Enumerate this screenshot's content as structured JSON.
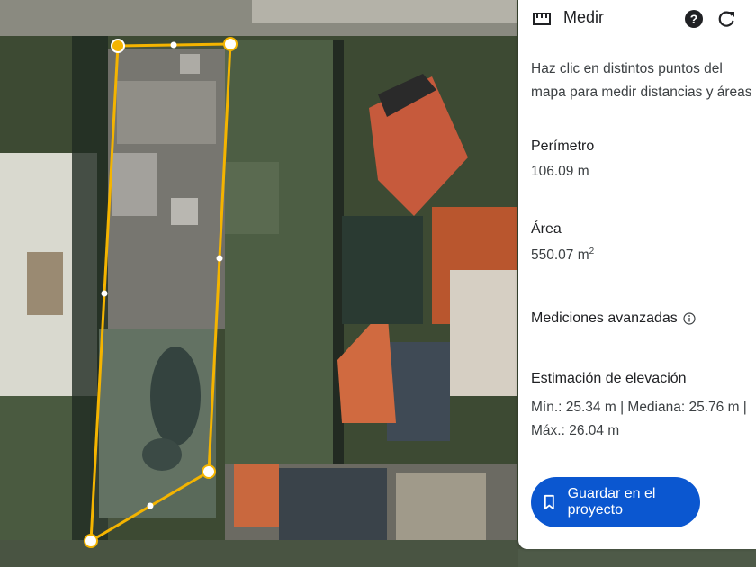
{
  "panel": {
    "title": "Medir",
    "icons": {
      "tool": "ruler-icon",
      "help": "help-icon",
      "reset": "refresh-icon"
    },
    "instructions": "Haz clic en distintos puntos del mapa para medir distancias y áreas",
    "perimeter_label": "Perímetro",
    "perimeter_value": "106.09 m",
    "area_label": "Área",
    "area_value": "550.07 m",
    "area_unit_sup": "2",
    "advanced_label": "Mediciones avanzadas",
    "elevation_label": "Estimación de elevación",
    "elevation_text": "Mín.: 25.34 m | Mediana: 25.76 m | Máx.: 26.04 m",
    "save_label": "Guardar en el proyecto"
  },
  "colors": {
    "measure_line": "#f4b400",
    "primary_button": "#0b57d0"
  }
}
